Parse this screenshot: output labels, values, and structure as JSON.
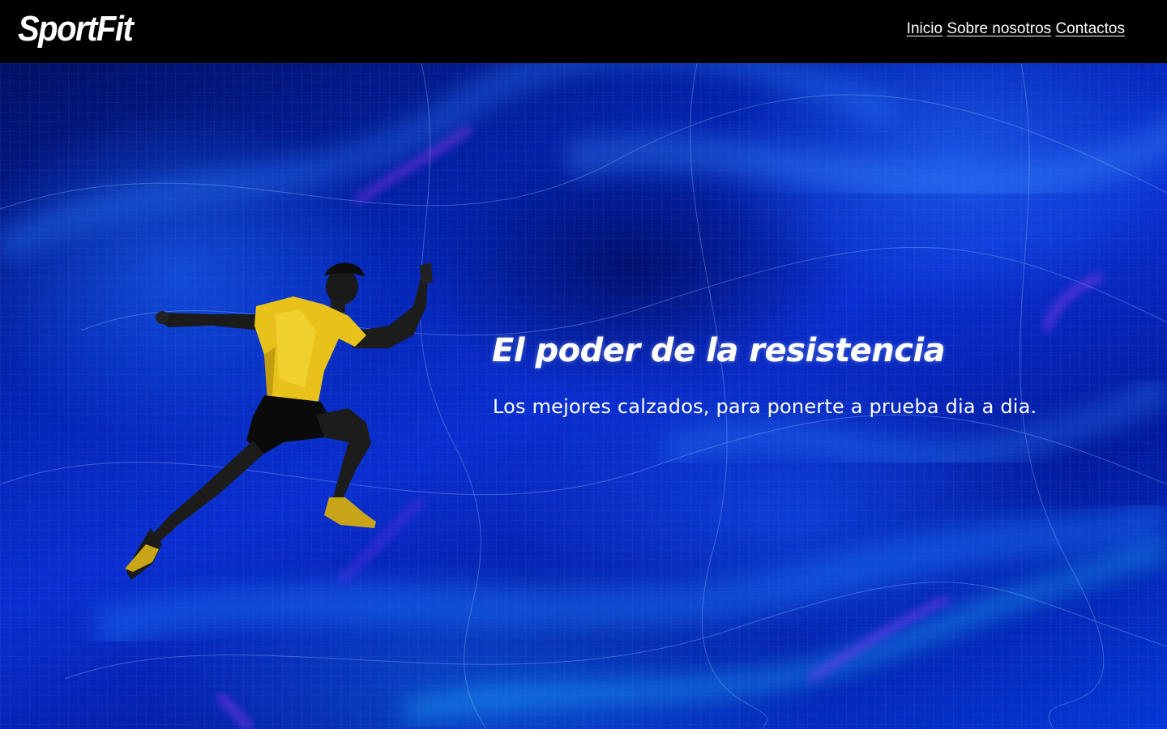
{
  "header": {
    "logo": "SportFit",
    "nav": [
      {
        "label": "Inicio"
      },
      {
        "label": "Sobre nosotros"
      },
      {
        "label": "Contactos"
      }
    ]
  },
  "hero": {
    "title": "El poder de la resistencia",
    "subtitle": "Los mejores calzados, para ponerte a prueba dia a dia.",
    "image": "runner-sprinting-in-yellow-shirt",
    "background": "abstract-blue-light-streaks"
  },
  "colors": {
    "header_bg": "#000000",
    "hero_blue": "#0a2fd0",
    "shirt_yellow": "#e8c21a",
    "accent_magenta": "#b030ff",
    "text": "#ffffff"
  }
}
